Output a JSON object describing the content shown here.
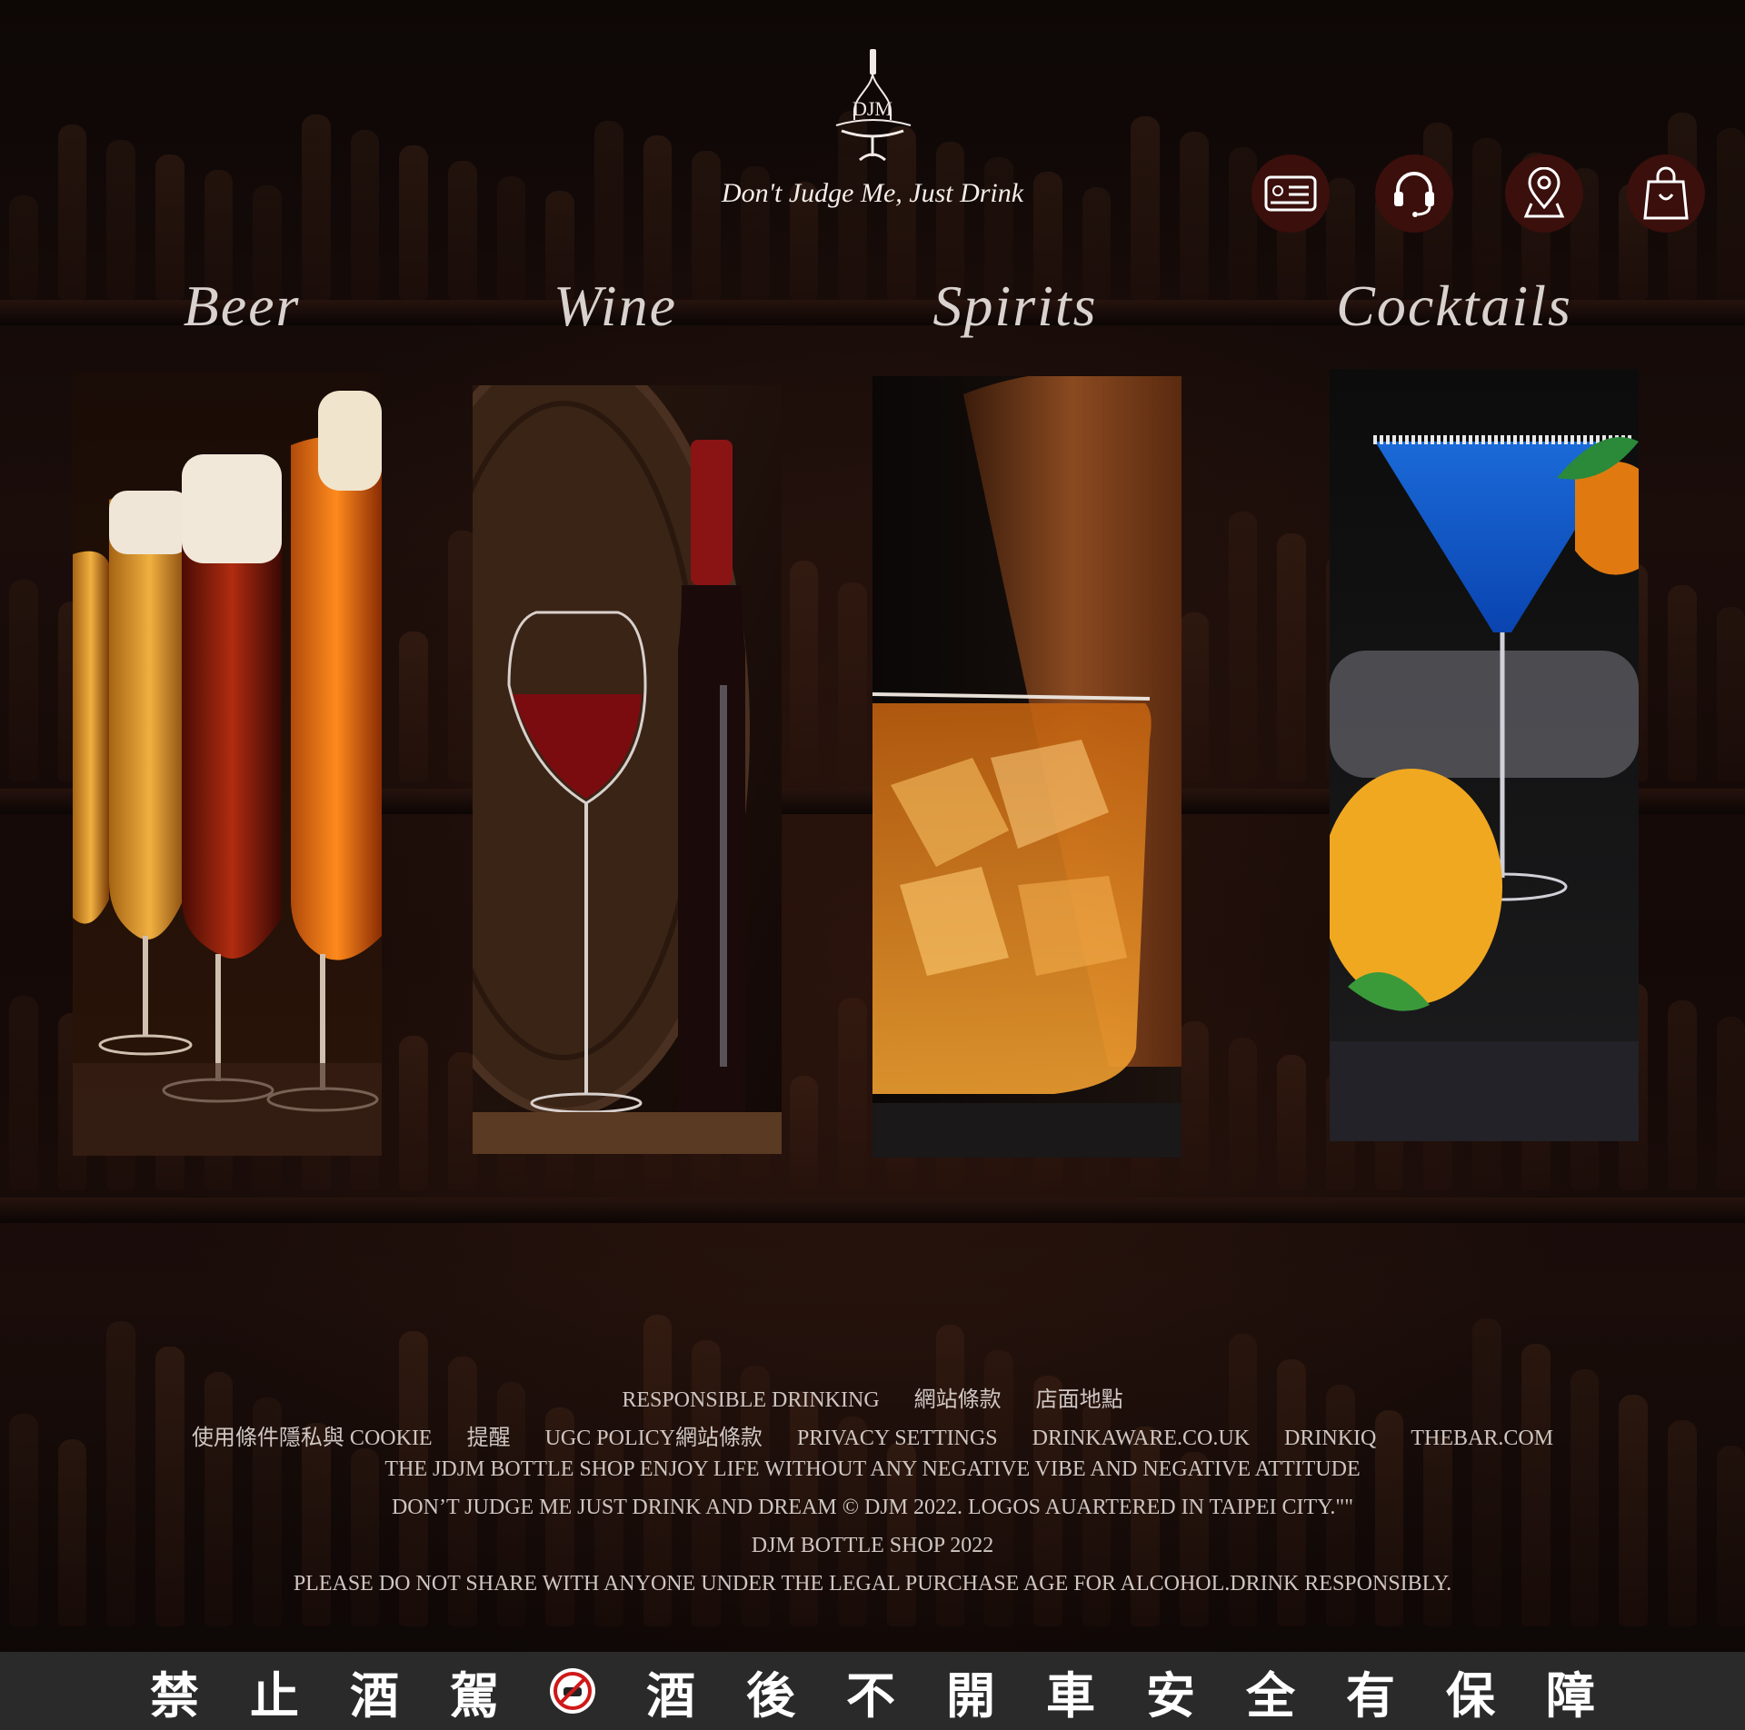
{
  "brand": {
    "logo_text": "DJM",
    "tagline": "Don't Judge Me, Just Drink"
  },
  "header_icons": [
    {
      "name": "membership-card-icon"
    },
    {
      "name": "customer-service-icon"
    },
    {
      "name": "store-location-icon"
    },
    {
      "name": "shopping-bag-icon"
    }
  ],
  "categories": [
    {
      "label": "Beer",
      "image": "beer glasses"
    },
    {
      "label": "Wine",
      "image": "red wine glass and bottle"
    },
    {
      "label": "Spirits",
      "image": "whiskey on the rocks"
    },
    {
      "label": "Cocktails",
      "image": "blue cocktail with lemon"
    }
  ],
  "footer": {
    "row1": [
      "RESPONSIBLE DRINKING",
      "網站條款",
      "店面地點"
    ],
    "row2": [
      "使用條件隱私與 COOKIE",
      "提醒",
      "UGC POLICY網站條款",
      "PRIVACY SETTINGS",
      "DRINKAWARE.CO.UK",
      "DRINKIQ",
      "THEBAR.COM"
    ],
    "line3": "THE JDJM BOTTLE SHOP ENJOY LIFE WITHOUT ANY NEGATIVE VIBE AND NEGATIVE ATTITUDE",
    "line4": "DON’T JUDGE ME JUST DRINK AND DREAM  © DJM 2022. LOGOS AUARTERED IN TAIPEI CITY.\"\"",
    "line5": "DJM BOTTLE SHOP 2022",
    "line6": "PLEASE DO NOT SHARE WITH ANYONE UNDER THE LEGAL PURCHASE AGE FOR ALCOHOL.DRINK RESPONSIBLY."
  },
  "banner": {
    "left": [
      "禁",
      "止",
      "酒",
      "駕"
    ],
    "right": [
      "酒",
      "後",
      "不",
      "開",
      "車",
      "安",
      "全",
      "有",
      "保",
      "障"
    ]
  },
  "colors": {
    "background": "#0b0605",
    "icon_bg": "#3a0f0c",
    "banner_bg": "#2a2a2a",
    "text": "#e8e0dc"
  }
}
